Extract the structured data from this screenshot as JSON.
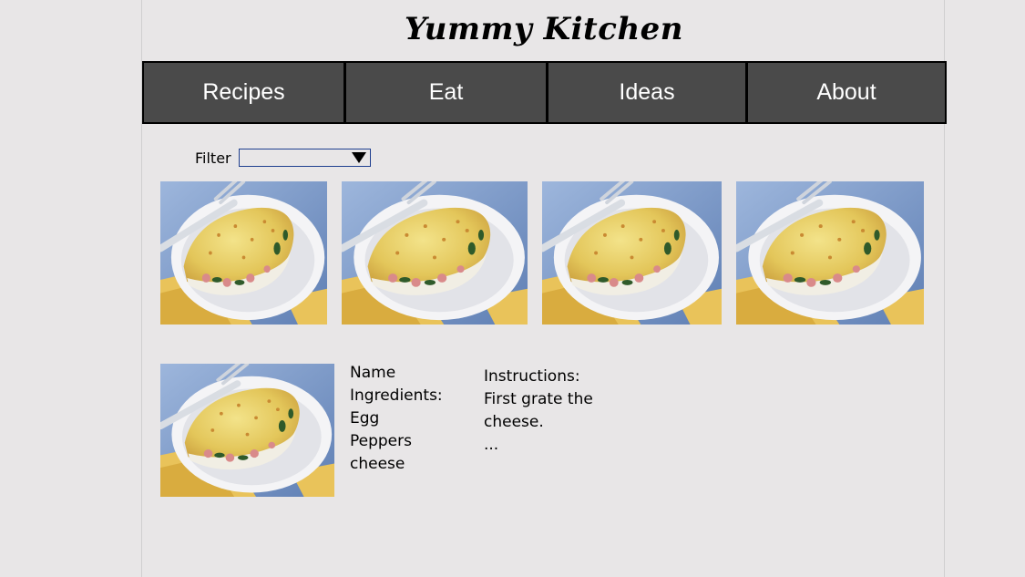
{
  "site": {
    "title": "Yummy Kitchen"
  },
  "nav": {
    "items": [
      {
        "label": "Recipes"
      },
      {
        "label": "Eat"
      },
      {
        "label": "Ideas"
      },
      {
        "label": "About"
      }
    ]
  },
  "filter": {
    "label": "Filter",
    "selected": ""
  },
  "gallery": {
    "images": [
      {
        "icon": "omelette-photo"
      },
      {
        "icon": "omelette-photo"
      },
      {
        "icon": "omelette-photo"
      },
      {
        "icon": "omelette-photo"
      }
    ]
  },
  "detail": {
    "image": {
      "icon": "omelette-photo"
    },
    "name_label": "Name",
    "ingredients_label": "Ingredients:",
    "ingredients": [
      "Egg",
      "Peppers",
      "cheese"
    ],
    "instructions_label": "Instructions:",
    "instructions": [
      "First grate the",
      "cheese.",
      "..."
    ]
  },
  "colors": {
    "background": "#e8e6e7",
    "nav_bg": "#4a4a4a",
    "nav_text": "#ffffff"
  }
}
